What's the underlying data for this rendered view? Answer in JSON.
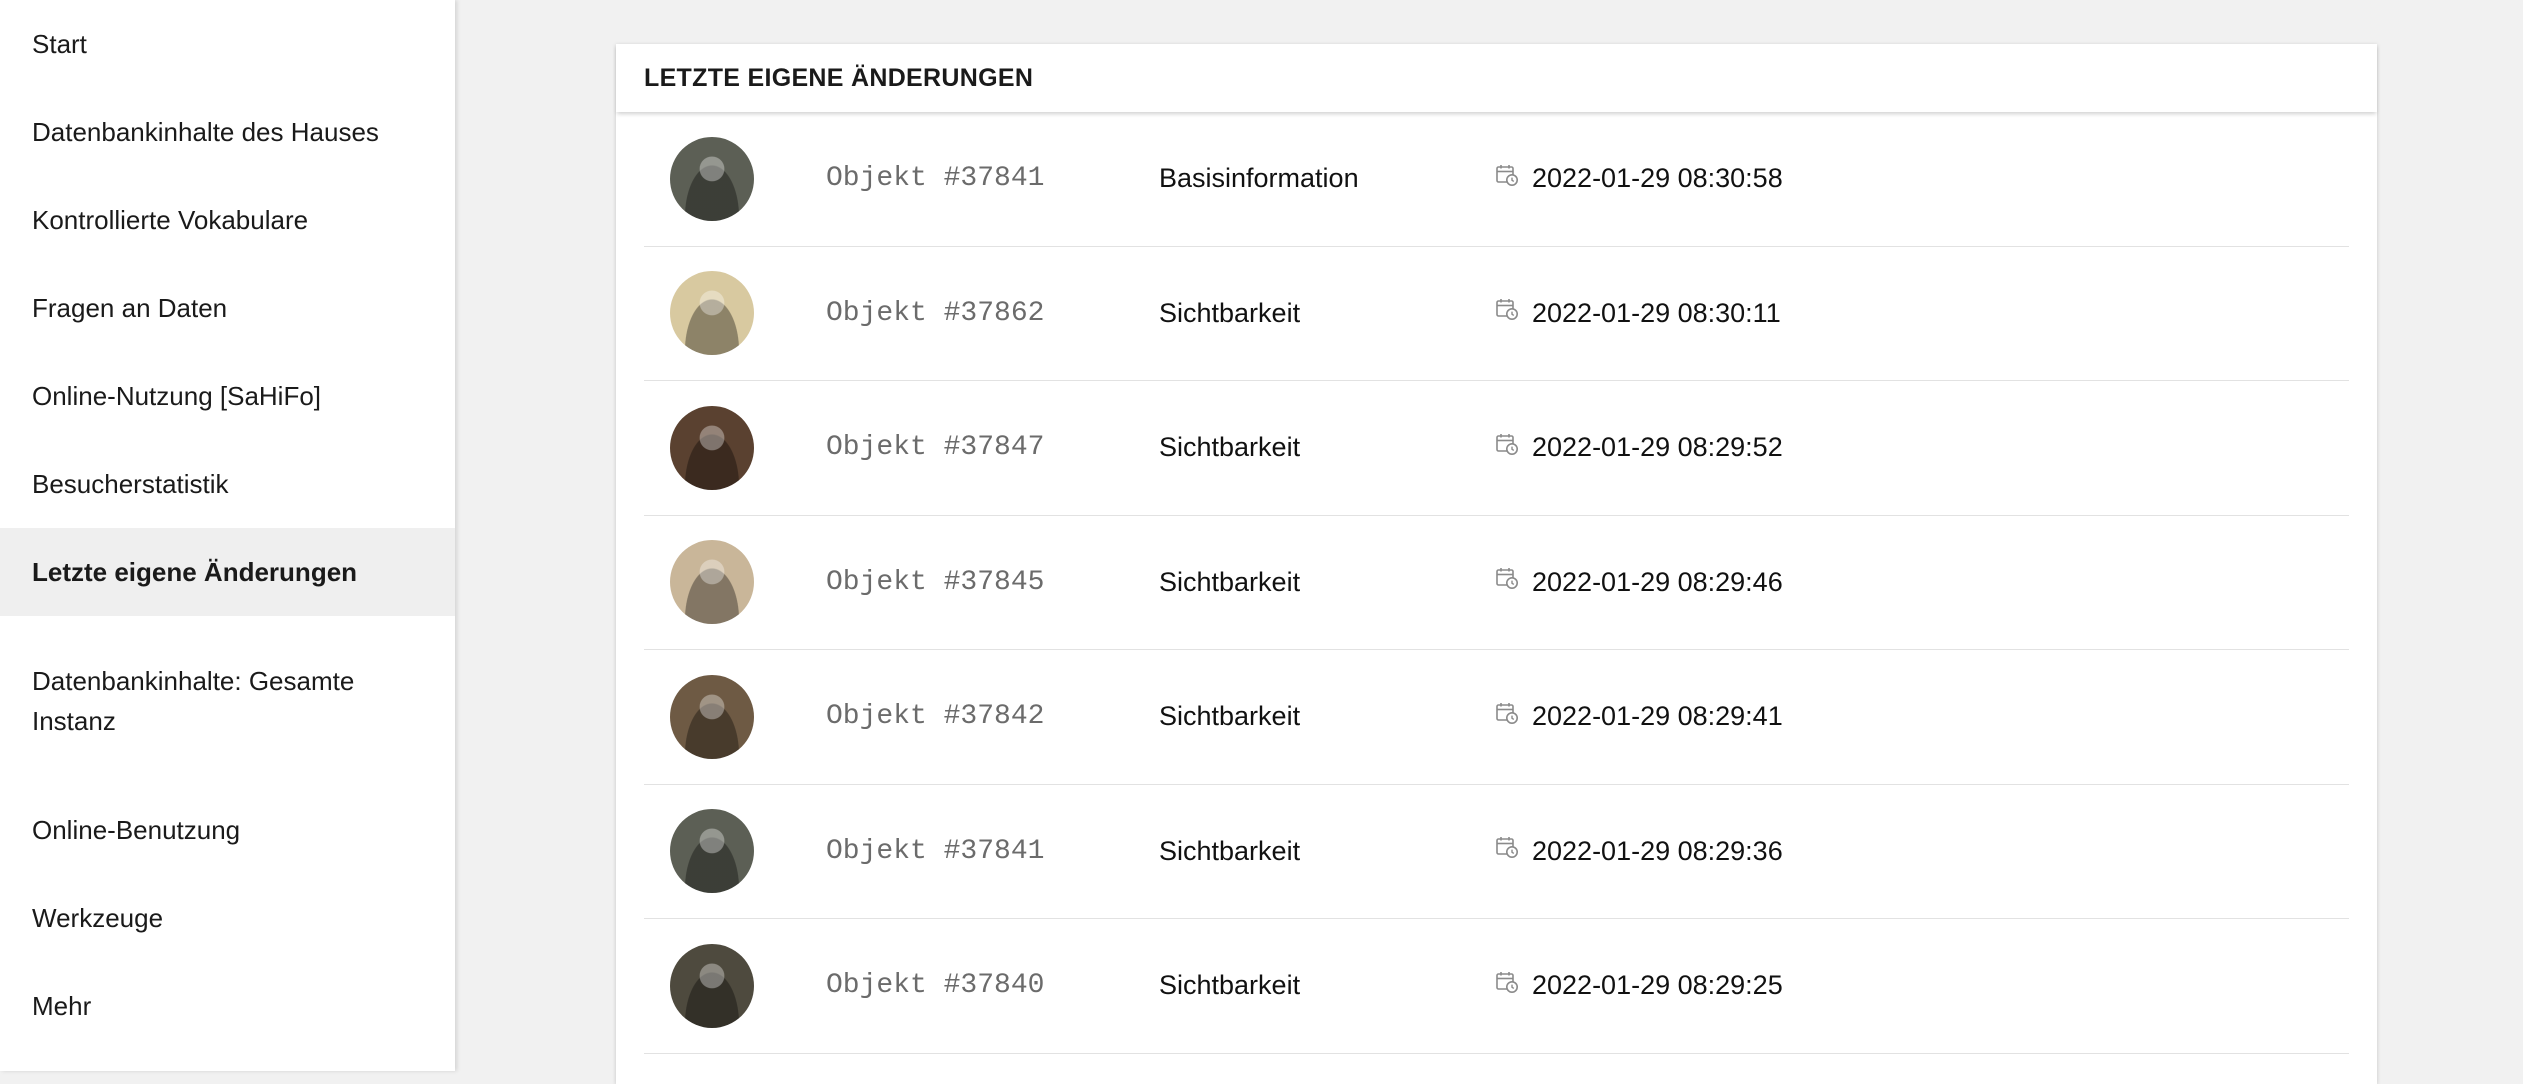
{
  "sidebar": {
    "items": [
      {
        "label": "Start",
        "active": false
      },
      {
        "label": "Datenbankinhalte des Hauses",
        "active": false
      },
      {
        "label": "Kontrollierte Vokabulare",
        "active": false
      },
      {
        "label": "Fragen an Daten",
        "active": false
      },
      {
        "label": "Online-Nutzung [SaHiFo]",
        "active": false
      },
      {
        "label": "Besucherstatistik",
        "active": false
      },
      {
        "label": "Letzte eigene Änderungen",
        "active": true
      },
      {
        "label": "Datenbankinhalte: Gesamte Instanz",
        "active": false
      },
      {
        "label": "Online-Benutzung",
        "active": false
      },
      {
        "label": "Werkzeuge",
        "active": false
      },
      {
        "label": "Mehr",
        "active": false
      }
    ]
  },
  "main": {
    "card_title": "LETZTE EIGENE ÄNDERUNGEN",
    "rows": [
      {
        "object": "Objekt #37841",
        "section": "Basisinformation",
        "timestamp": "2022-01-29 08:30:58",
        "thumb_color": "#5c5f55"
      },
      {
        "object": "Objekt #37862",
        "section": "Sichtbarkeit",
        "timestamp": "2022-01-29 08:30:11",
        "thumb_color": "#d8c9a0"
      },
      {
        "object": "Objekt #37847",
        "section": "Sichtbarkeit",
        "timestamp": "2022-01-29 08:29:52",
        "thumb_color": "#5a4130"
      },
      {
        "object": "Objekt #37845",
        "section": "Sichtbarkeit",
        "timestamp": "2022-01-29 08:29:46",
        "thumb_color": "#c9b699"
      },
      {
        "object": "Objekt #37842",
        "section": "Sichtbarkeit",
        "timestamp": "2022-01-29 08:29:41",
        "thumb_color": "#6e5a44"
      },
      {
        "object": "Objekt #37841",
        "section": "Sichtbarkeit",
        "timestamp": "2022-01-29 08:29:36",
        "thumb_color": "#5c5f55"
      },
      {
        "object": "Objekt #37840",
        "section": "Sichtbarkeit",
        "timestamp": "2022-01-29 08:29:25",
        "thumb_color": "#4e4a3e"
      }
    ]
  },
  "icons": {
    "row_thumbnail": "photo-thumbnail",
    "timestamp": "calendar-clock-icon"
  }
}
